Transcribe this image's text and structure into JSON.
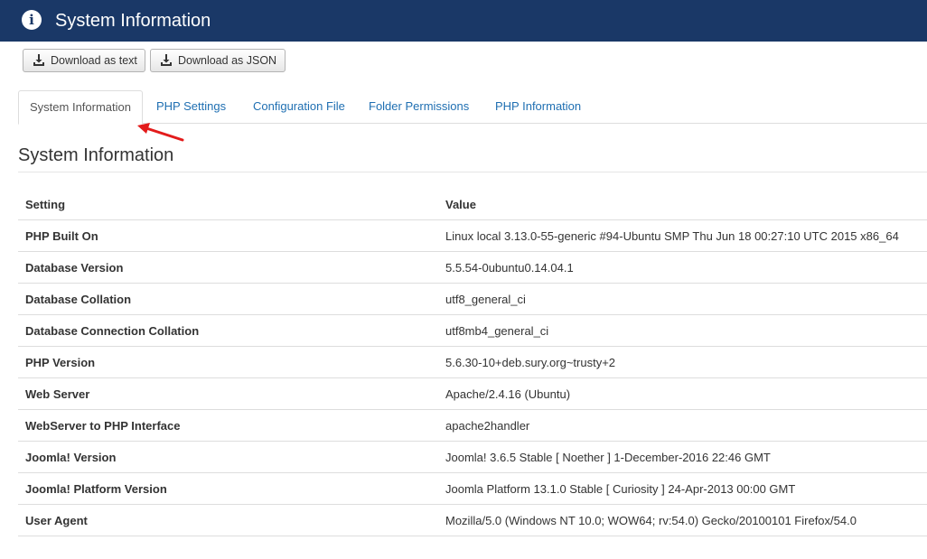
{
  "header": {
    "title": "System Information",
    "icon": "info-icon",
    "color": "#1a3867"
  },
  "toolbar": {
    "download_text_label": "Download as text",
    "download_json_label": "Download as JSON",
    "icon": "download-icon"
  },
  "tabs": [
    {
      "label": "System Information",
      "active": true
    },
    {
      "label": "PHP Settings"
    },
    {
      "label": "Configuration File"
    },
    {
      "label": "Folder Permissions"
    },
    {
      "label": "PHP Information"
    }
  ],
  "section": {
    "title": "System Information"
  },
  "table": {
    "headers": [
      "Setting",
      "Value"
    ],
    "rows": [
      {
        "setting": "PHP Built On",
        "value": "Linux local 3.13.0-55-generic #94-Ubuntu SMP Thu Jun 18 00:27:10 UTC 2015 x86_64"
      },
      {
        "setting": "Database Version",
        "value": "5.5.54-0ubuntu0.14.04.1"
      },
      {
        "setting": "Database Collation",
        "value": "utf8_general_ci"
      },
      {
        "setting": "Database Connection Collation",
        "value": "utf8mb4_general_ci"
      },
      {
        "setting": "PHP Version",
        "value": "5.6.30-10+deb.sury.org~trusty+2"
      },
      {
        "setting": "Web Server",
        "value": "Apache/2.4.16 (Ubuntu)"
      },
      {
        "setting": "WebServer to PHP Interface",
        "value": "apache2handler"
      },
      {
        "setting": "Joomla! Version",
        "value": "Joomla! 3.6.5 Stable [ Noether ] 1-December-2016 22:46 GMT"
      },
      {
        "setting": "Joomla! Platform Version",
        "value": "Joomla Platform 13.1.0 Stable [ Curiosity ] 24-Apr-2013 00:00 GMT"
      },
      {
        "setting": "User Agent",
        "value": "Mozilla/5.0 (Windows NT 10.0; WOW64; rv:54.0) Gecko/20100101 Firefox/54.0"
      }
    ]
  },
  "annotation": {
    "icon": "red-arrow-icon",
    "color": "#e31b1b"
  }
}
